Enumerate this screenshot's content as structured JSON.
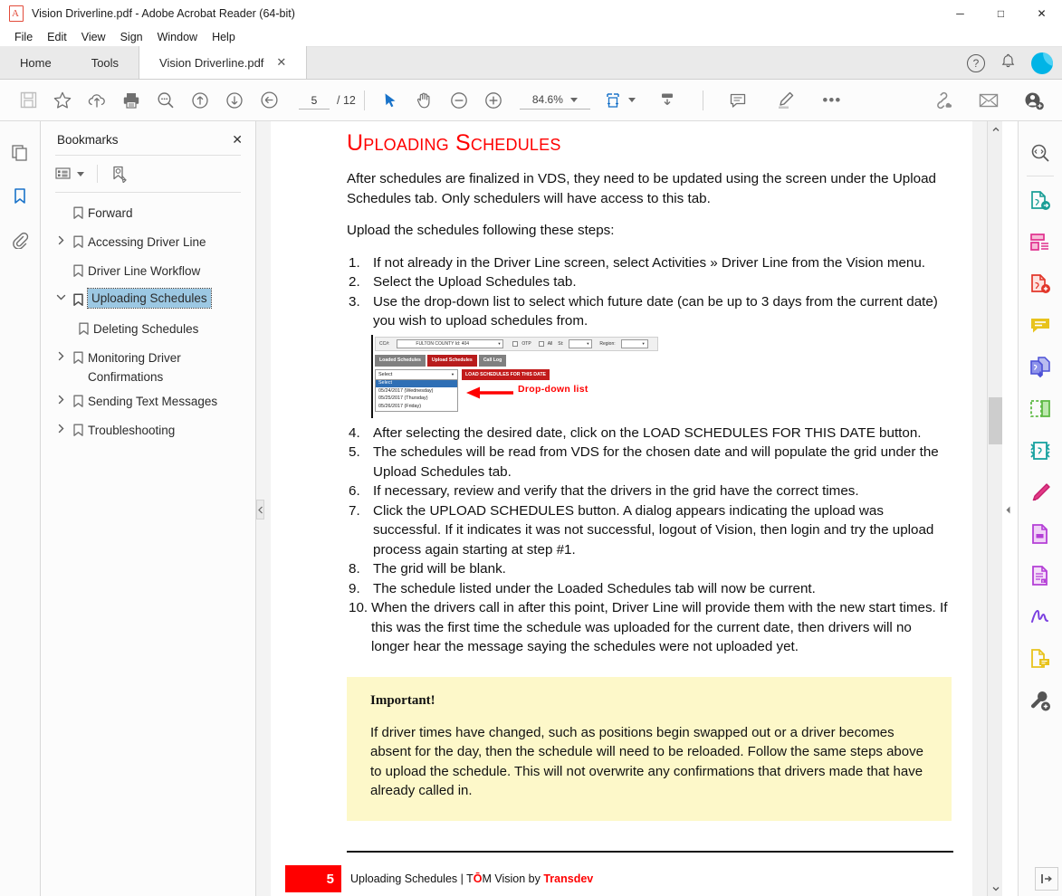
{
  "window": {
    "title": "Vision Driverline.pdf - Adobe Acrobat Reader (64-bit)",
    "minimize": "─",
    "maximize": "□",
    "close": "✕"
  },
  "menubar": {
    "items": [
      "File",
      "Edit",
      "View",
      "Sign",
      "Window",
      "Help"
    ]
  },
  "tabs": {
    "home": "Home",
    "tools": "Tools",
    "document": "Vision Driverline.pdf",
    "close_label": "✕",
    "help_icon": "?",
    "bell_icon": "bell-icon",
    "avatar_icon": "avatar"
  },
  "toolbar": {
    "save_icon": "save-icon",
    "star_icon": "star-icon",
    "cloud_upload_icon": "cloud-upload-icon",
    "print_icon": "print-icon",
    "find_icon": "find-icon",
    "page_up_icon": "page-up-icon",
    "page_down_icon": "page-down-icon",
    "back_icon": "previous-view-icon",
    "current_page": "5",
    "total_pages": "/ 12",
    "select_icon": "select-tool-icon",
    "hand_icon": "hand-tool-icon",
    "zoom_out_icon": "zoom-out-icon",
    "zoom_in_icon": "zoom-in-icon",
    "zoom_level": "84.6%",
    "fit_icon": "fit-page-icon",
    "scroll_mode_icon": "scroll-mode-icon",
    "comment_icon": "comment-icon",
    "highlight_icon": "highlight-icon",
    "more_icon": "•••",
    "share_link_icon": "share-link-icon",
    "email_icon": "email-icon",
    "add_user_icon": "add-user-icon"
  },
  "left_rail": {
    "thumbnails": "page-thumbnails-icon",
    "bookmarks": "bookmarks-icon",
    "attachments": "attachments-icon"
  },
  "bookmarks_panel": {
    "title": "Bookmarks",
    "close": "✕",
    "options_icon": "bookmark-options-icon",
    "new_bookmark_icon": "new-bookmark-icon",
    "items": [
      {
        "label": "Forward",
        "expandable": false,
        "level": 0,
        "selected": false
      },
      {
        "label": "Accessing Driver Line",
        "expandable": true,
        "expanded": false,
        "level": 0,
        "selected": false
      },
      {
        "label": "Driver Line Workflow",
        "expandable": false,
        "level": 0,
        "selected": false
      },
      {
        "label": "Uploading Schedules",
        "expandable": true,
        "expanded": true,
        "level": 0,
        "selected": true
      },
      {
        "label": "Deleting Schedules",
        "expandable": false,
        "level": 1,
        "selected": false
      },
      {
        "label": "Monitoring Driver Confirmations",
        "expandable": true,
        "expanded": false,
        "level": 0,
        "selected": false
      },
      {
        "label": "Sending Text Messages",
        "expandable": true,
        "expanded": false,
        "level": 0,
        "selected": false
      },
      {
        "label": "Troubleshooting",
        "expandable": true,
        "expanded": false,
        "level": 0,
        "selected": false
      }
    ]
  },
  "document": {
    "heading": "Uploading Schedules",
    "intro1": "After schedules are finalized in VDS, they need to be updated using the screen under the Upload Schedules tab.  Only schedulers will have access to this tab.",
    "intro2": "Upload the schedules following these steps:",
    "steps": [
      {
        "num": "1.",
        "text": "If not already in the Driver Line screen, select Activities » Driver Line from the Vision menu."
      },
      {
        "num": "2.",
        "text": "Select the Upload Schedules tab."
      },
      {
        "num": "3.",
        "text": "Use the drop-down list to select which future date (can be up to 3 days from the current date) you wish to upload schedules from."
      },
      {
        "num": "4.",
        "text": "After selecting the desired date, click on the LOAD SCHEDULES FOR THIS DATE button."
      },
      {
        "num": "5.",
        "text": "The schedules will be read from VDS for the chosen date and will populate the grid under the Upload Schedules tab."
      },
      {
        "num": "6.",
        "text": "If necessary, review and verify that the drivers in the grid have the correct times."
      },
      {
        "num": "7.",
        "text": "Click the UPLOAD SCHEDULES button.  A dialog appears indicating the upload was successful.  If it indicates it was not successful, logout of Vision, then login and try the upload process again starting at step #1."
      },
      {
        "num": "8.",
        "text": "The grid will be blank."
      },
      {
        "num": "9.",
        "text": "The schedule listed under the Loaded Schedules tab will now be current."
      },
      {
        "num": "10.",
        "text": "When the drivers call in after this point, Driver Line will provide them with the new start times.  If this was the first time the schedule was uploaded for the current date, then drivers will no longer hear the message saying the schedules were not uploaded yet."
      }
    ],
    "figure": {
      "cc_label": "CC#:",
      "cc_value": "FULTON COUNTY Id: 404",
      "otp_label": "OTP",
      "all_label": "All",
      "st_label": "St:",
      "region_label": "Region:",
      "tabs": [
        "Loaded Schedules",
        "Upload Schedules",
        "Call Log"
      ],
      "active_tab": "Upload Schedules",
      "dropdown_value": "Select",
      "load_button": "LOAD SCHEDULES FOR THIS DATE",
      "options": [
        "Select",
        "05/24/2017 (Wednesday)",
        "05/25/2017 (Thursday)",
        "05/26/2017 (Friday)"
      ],
      "selected_option": "Select",
      "annotation": "Drop-down list",
      "annotation_color": "#ff0000"
    },
    "important": {
      "title": "Important!",
      "body": "If driver times have changed, such as positions begin swapped out or a driver becomes absent for the day, then the schedule will need to be reloaded.  Follow the same steps above to upload the schedule.  This will not overwrite any confirmations that drivers made that have already called in."
    },
    "footer": {
      "page_number": "5",
      "text_before": "Uploading Schedules | T",
      "accent_letter": "Ō",
      "text_middle": "M Vision by ",
      "brand": "Transdev"
    }
  },
  "right_rail": {
    "items": [
      "search-enhanced-icon",
      "export-pdf-icon",
      "create-pdf-icon",
      "edit-pdf-icon",
      "comment-icon",
      "combine-files-icon",
      "organize-pages-icon",
      "compress-pdf-icon",
      "redact-icon",
      "protect-icon",
      "stamp-icon",
      "fill-and-sign-icon",
      "send-for-comments-icon",
      "more-tools-icon"
    ],
    "expand_panel_icon": "expand-right-panel-icon"
  },
  "scrollbar": {
    "up_arrow": "⌃",
    "down_arrow": "⌄",
    "collapse_left": "◀",
    "collapse_right": "◀"
  },
  "colors": {
    "heading_red": "#ff0000",
    "selection_blue": "#9cc8e3",
    "note_bg": "#fdf8c9",
    "accent_blue": "#1a73c9"
  }
}
